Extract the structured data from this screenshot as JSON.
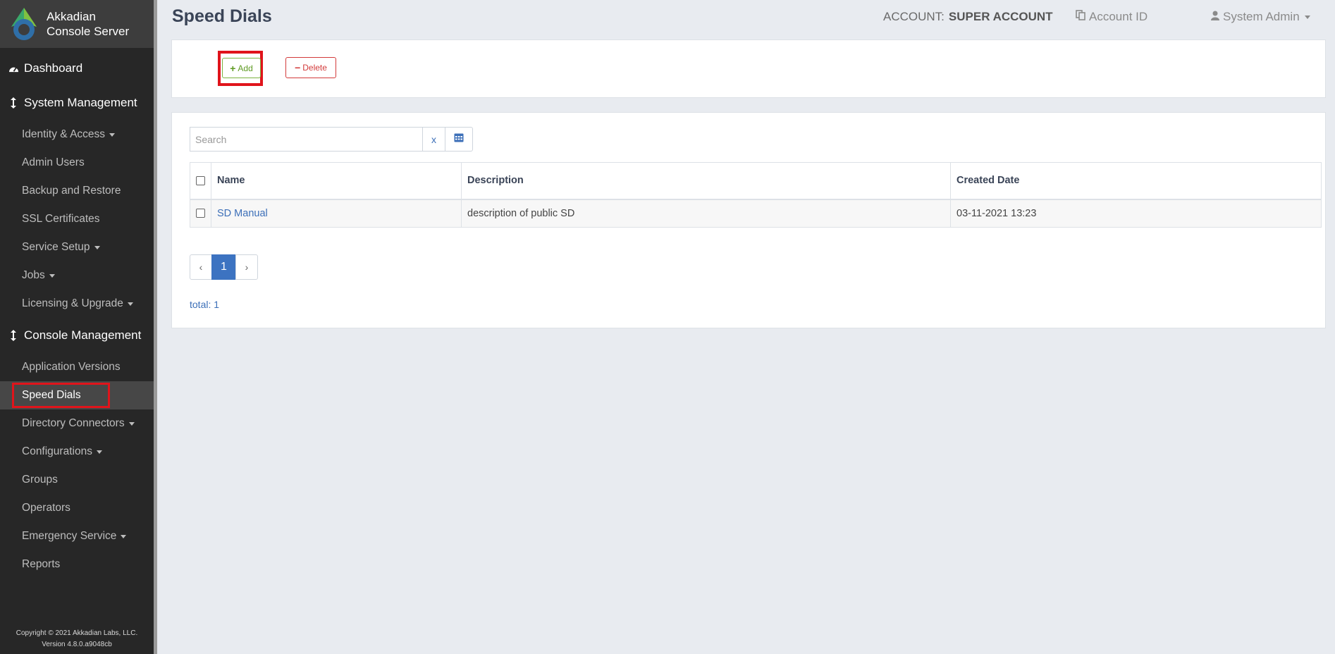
{
  "brand": {
    "line1": "Akkadian",
    "line2": "Console Server"
  },
  "sidebar": {
    "sections": [
      {
        "label": "Dashboard",
        "icon": "speedometer-icon"
      },
      {
        "label": "System Management",
        "icon": "arrows-vertical-icon",
        "items": [
          {
            "label": "Identity & Access",
            "has_caret": true
          },
          {
            "label": "Admin Users"
          },
          {
            "label": "Backup and Restore"
          },
          {
            "label": "SSL Certificates"
          },
          {
            "label": "Service Setup",
            "has_caret": true
          },
          {
            "label": "Jobs",
            "has_caret": true
          },
          {
            "label": "Licensing & Upgrade",
            "has_caret": true
          }
        ]
      },
      {
        "label": "Console Management",
        "icon": "arrows-vertical-icon",
        "items": [
          {
            "label": "Application Versions"
          },
          {
            "label": "Speed Dials",
            "active": true
          },
          {
            "label": "Directory Connectors",
            "has_caret": true
          },
          {
            "label": "Configurations",
            "has_caret": true
          },
          {
            "label": "Groups"
          },
          {
            "label": "Operators"
          },
          {
            "label": "Emergency Service",
            "has_caret": true
          },
          {
            "label": "Reports"
          }
        ]
      }
    ],
    "footer": {
      "copyright": "Copyright © 2021 Akkadian Labs, LLC.",
      "version": "Version 4.8.0.a9048cb"
    }
  },
  "header": {
    "title": "Speed Dials",
    "account_label": "ACCOUNT:",
    "account_value": "SUPER ACCOUNT",
    "account_id": "Account ID",
    "user": "System Admin"
  },
  "toolbar": {
    "add_label": "Add",
    "delete_label": "Delete"
  },
  "search": {
    "placeholder": "Search",
    "clear_label": "x"
  },
  "table": {
    "columns": [
      "Name",
      "Description",
      "Created Date"
    ],
    "rows": [
      {
        "name": "SD Manual",
        "description": "description of public SD",
        "created": "03-11-2021 13:23"
      }
    ]
  },
  "pagination": {
    "prev": "‹",
    "current": "1",
    "next": "›"
  },
  "total": "total: 1",
  "colors": {
    "sidebar_bg": "#272727",
    "accent_blue": "#3c73c1",
    "add_green": "#5e9a22",
    "delete_red": "#d33a3a",
    "highlight_red": "#e0141b"
  }
}
